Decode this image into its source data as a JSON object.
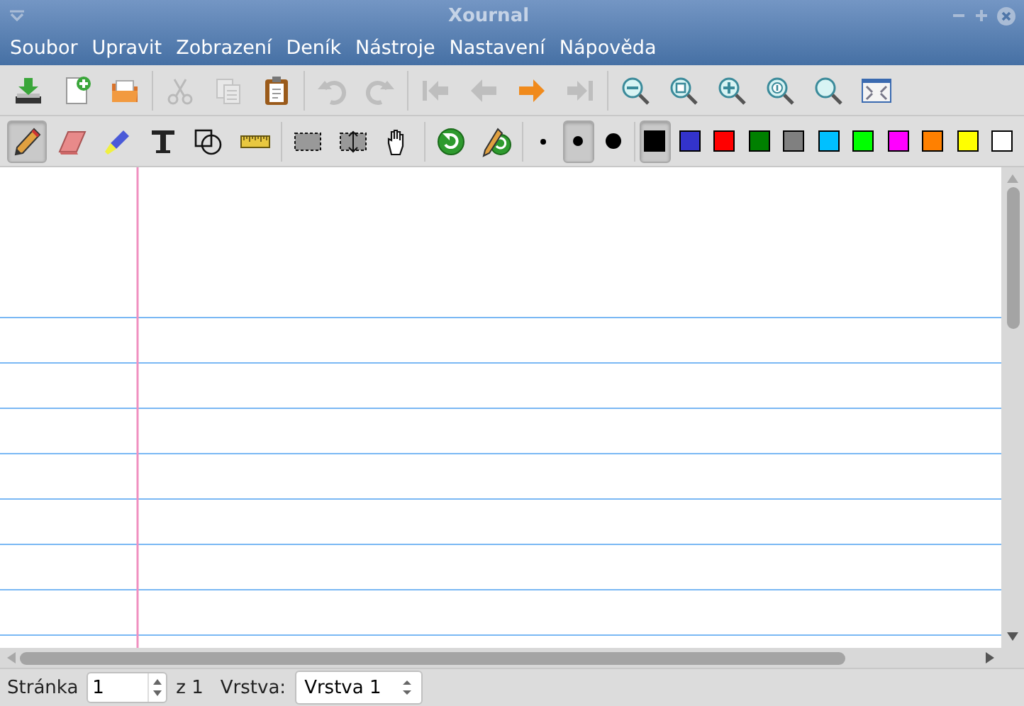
{
  "window": {
    "title": "Xournal"
  },
  "menu": [
    "Soubor",
    "Upravit",
    "Zobrazení",
    "Deník",
    "Nástroje",
    "Nastavení",
    "Nápověda"
  ],
  "toolbar": [
    {
      "kind": "save",
      "disabled": false
    },
    {
      "kind": "new",
      "disabled": false
    },
    {
      "kind": "open",
      "disabled": false
    },
    {
      "kind": "separator"
    },
    {
      "kind": "cut",
      "disabled": true
    },
    {
      "kind": "copy",
      "disabled": true
    },
    {
      "kind": "paste",
      "disabled": false
    },
    {
      "kind": "separator"
    },
    {
      "kind": "undo",
      "disabled": true
    },
    {
      "kind": "redo",
      "disabled": true
    },
    {
      "kind": "separator"
    },
    {
      "kind": "first",
      "disabled": true
    },
    {
      "kind": "prev",
      "disabled": true
    },
    {
      "kind": "next",
      "disabled": false
    },
    {
      "kind": "last",
      "disabled": true
    },
    {
      "kind": "separator"
    },
    {
      "kind": "zoom-out",
      "disabled": false
    },
    {
      "kind": "zoom-fit",
      "disabled": false
    },
    {
      "kind": "zoom-in",
      "disabled": false
    },
    {
      "kind": "zoom-100",
      "disabled": false
    },
    {
      "kind": "zoom",
      "disabled": false
    },
    {
      "kind": "fullscreen",
      "disabled": false
    }
  ],
  "tools": [
    {
      "kind": "pen",
      "selected": true
    },
    {
      "kind": "eraser",
      "selected": false
    },
    {
      "kind": "highlighter",
      "selected": false
    },
    {
      "kind": "text",
      "selected": false
    },
    {
      "kind": "shapes",
      "selected": false
    },
    {
      "kind": "ruler",
      "selected": false
    },
    {
      "kind": "separator"
    },
    {
      "kind": "select-rect",
      "selected": false
    },
    {
      "kind": "vertical-space",
      "selected": false
    },
    {
      "kind": "hand",
      "selected": false
    },
    {
      "kind": "separator"
    },
    {
      "kind": "default",
      "selected": false
    },
    {
      "kind": "default-pen",
      "selected": false
    },
    {
      "kind": "separator"
    }
  ],
  "pen_sizes": [
    {
      "kind": "thin",
      "selected": false
    },
    {
      "kind": "medium",
      "selected": true
    },
    {
      "kind": "thick",
      "selected": false
    }
  ],
  "colors": [
    {
      "color": "#000000",
      "selected": true
    },
    {
      "color": "#3333cc",
      "selected": false
    },
    {
      "color": "#ff0000",
      "selected": false
    },
    {
      "color": "#008000",
      "selected": false
    },
    {
      "color": "#808080",
      "selected": false
    },
    {
      "color": "#00c0ff",
      "selected": false
    },
    {
      "color": "#00ff00",
      "selected": false
    },
    {
      "color": "#ff00ff",
      "selected": false
    },
    {
      "color": "#ff8000",
      "selected": false
    },
    {
      "color": "#ffff00",
      "selected": false
    },
    {
      "color": "#ffffff",
      "selected": false
    }
  ],
  "status": {
    "page_label": "Stránka",
    "page": "1",
    "page_total": "z 1",
    "layer_label": "Vrstva:",
    "layer": "Vrstva 1"
  }
}
